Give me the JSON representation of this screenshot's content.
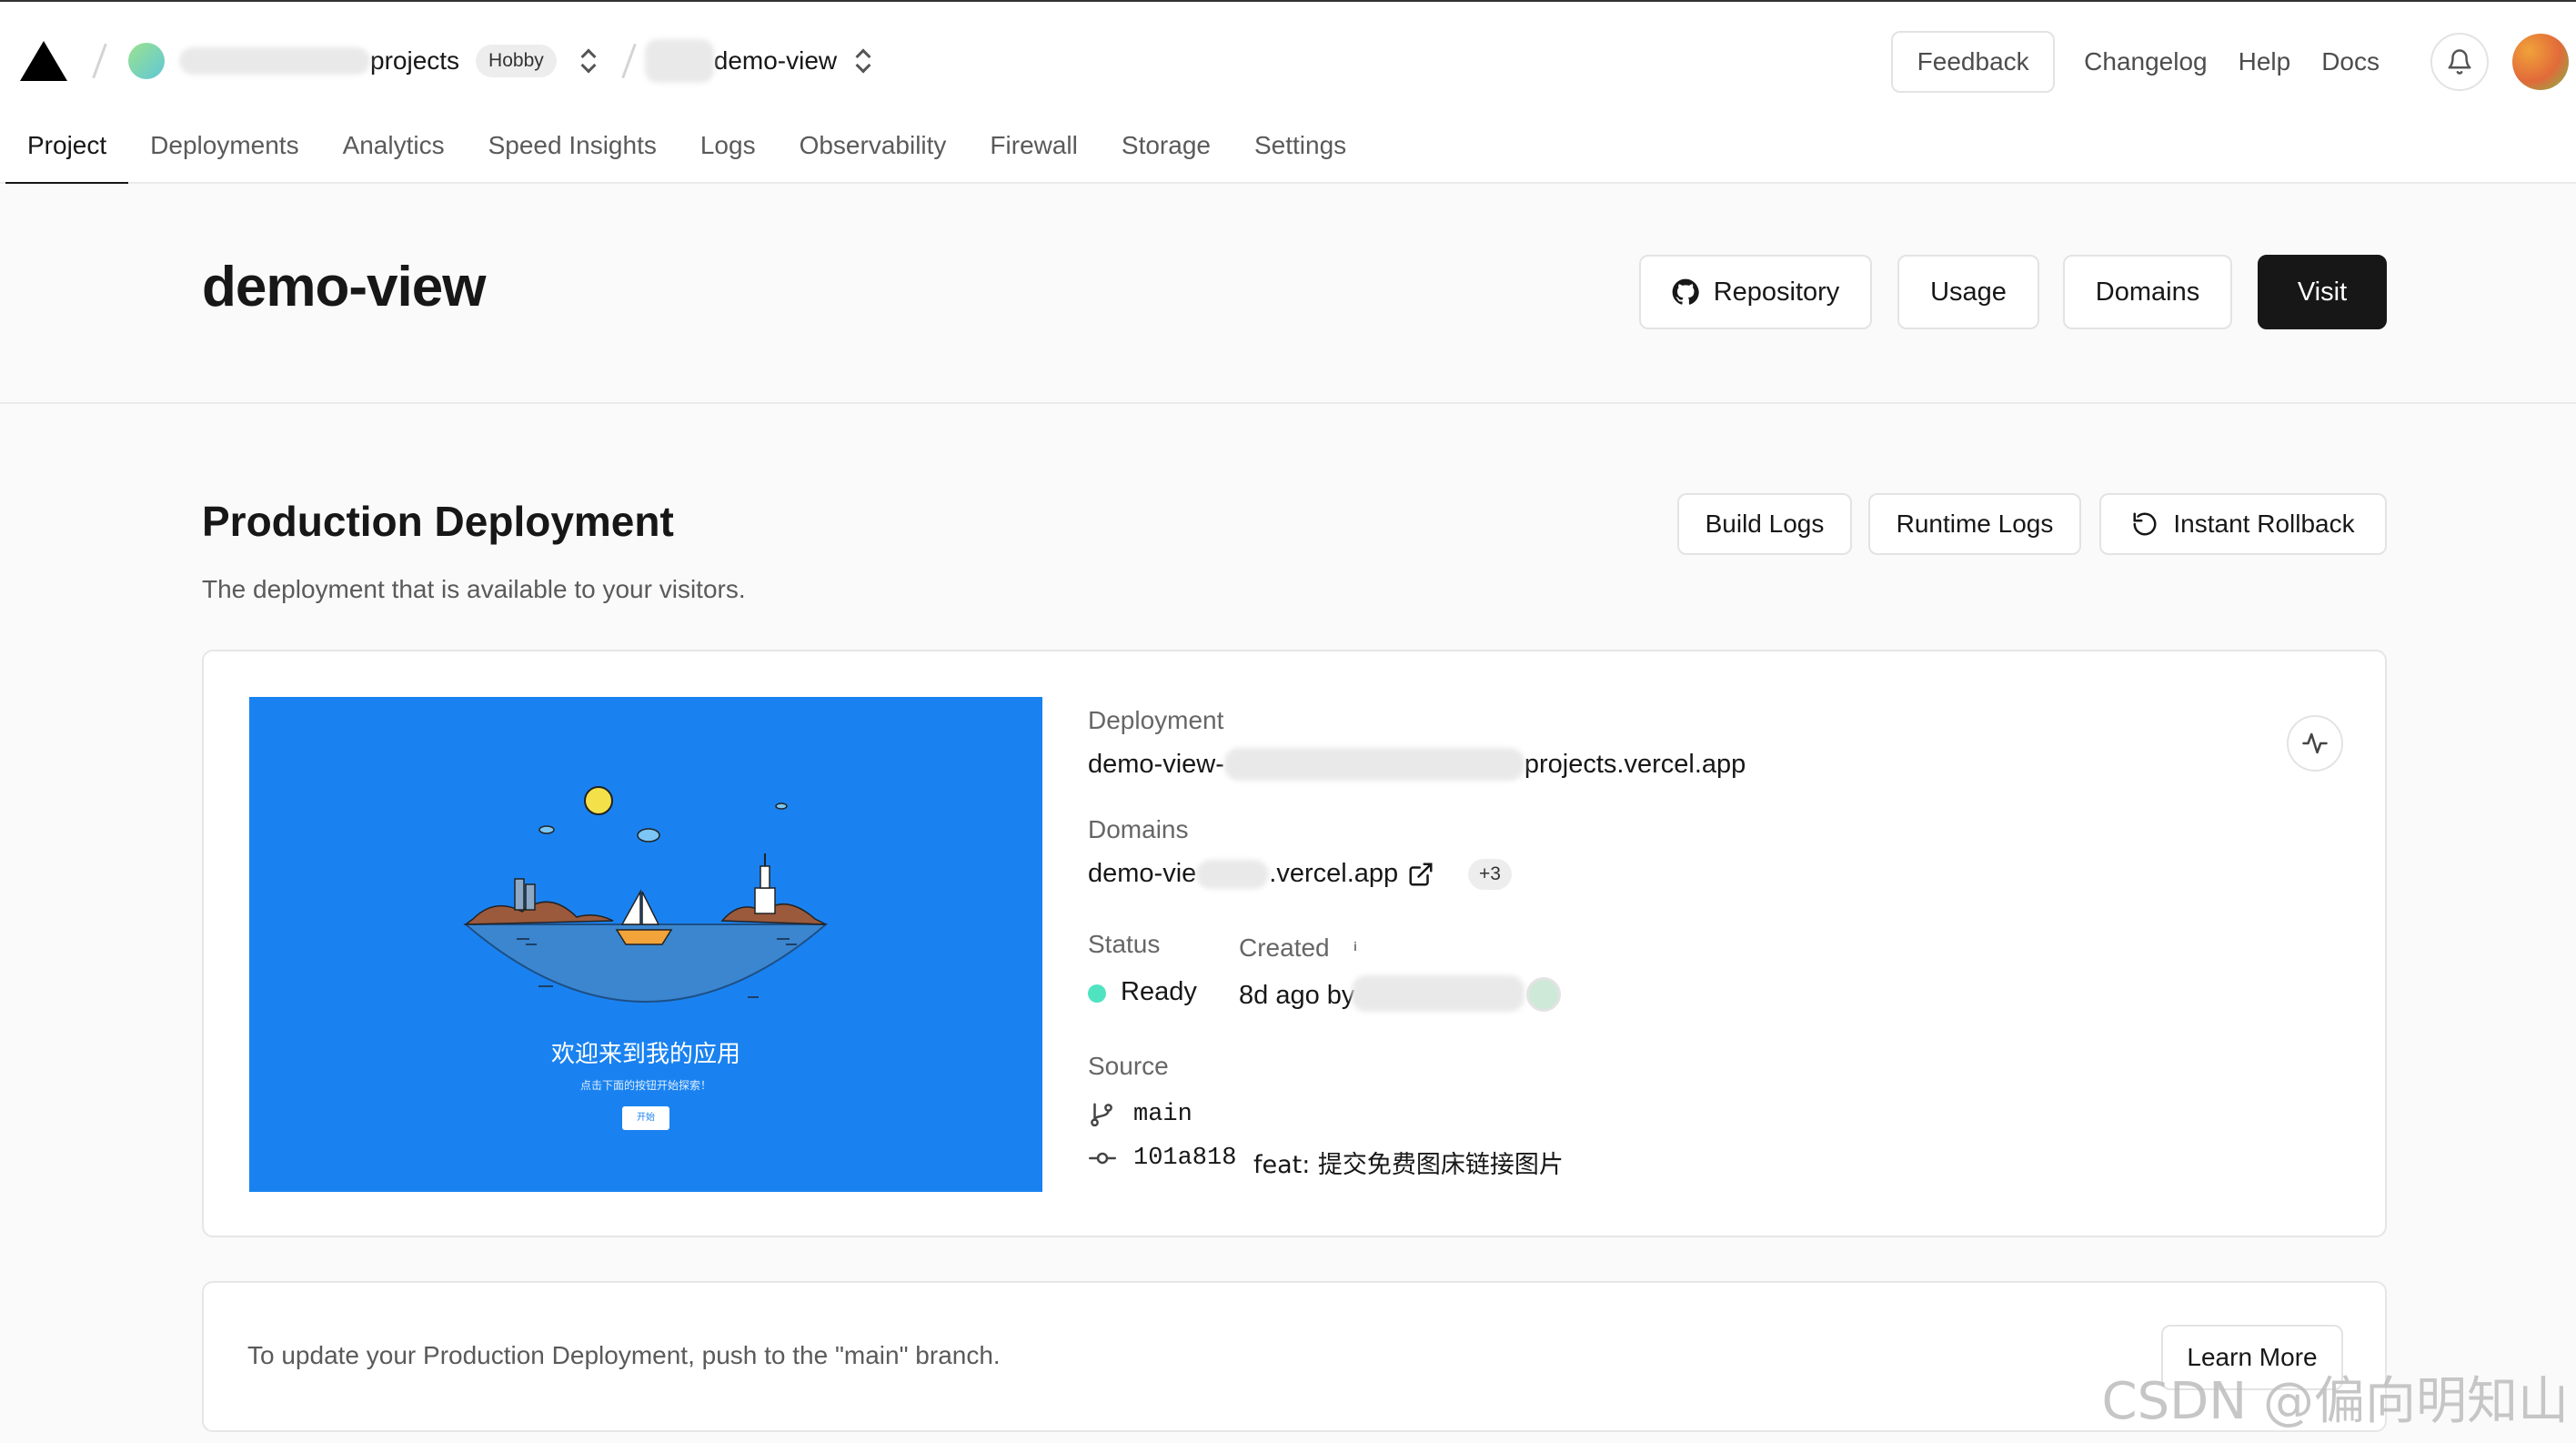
{
  "topbar": {
    "team_name": "projects",
    "team_plan": "Hobby",
    "project_name": "demo-view",
    "feedback_label": "Feedback",
    "links": [
      "Changelog",
      "Help",
      "Docs"
    ]
  },
  "tabs": [
    "Project",
    "Deployments",
    "Analytics",
    "Speed Insights",
    "Logs",
    "Observability",
    "Firewall",
    "Storage",
    "Settings"
  ],
  "header": {
    "title": "demo-view",
    "repository_label": "Repository",
    "usage_label": "Usage",
    "domains_label": "Domains",
    "visit_label": "Visit"
  },
  "production": {
    "title": "Production Deployment",
    "subtitle": "The deployment that is available to your visitors.",
    "build_logs_label": "Build Logs",
    "runtime_logs_label": "Runtime Logs",
    "rollback_label": "Instant Rollback"
  },
  "deployment": {
    "preview_heading": "欢迎来到我的应用",
    "preview_sub": "点击下面的按钮开始探索！",
    "preview_button": "开始",
    "deployment_label": "Deployment",
    "deployment_url_start": "demo-view-",
    "deployment_url_end": "projects.vercel.app",
    "domains_label": "Domains",
    "domain_start": "demo-vie",
    "domain_end": ".vercel.app",
    "domain_extra": "+3",
    "status_label": "Status",
    "status_value": "Ready",
    "created_label": "Created",
    "created_info": "i",
    "created_value": "8d ago by",
    "source_label": "Source",
    "branch": "main",
    "commit_hash": "101a818",
    "commit_message": "feat: 提交免费图床链接图片"
  },
  "notice": {
    "text": "To update your Production Deployment, push to the \"main\" branch.",
    "learn_more_label": "Learn More"
  },
  "watermark": "CSDN @偏向明知山",
  "colors": {
    "ready_dot": "#50e3c2",
    "preview_bg": "#1a82f0",
    "visit_bg": "#171717"
  }
}
